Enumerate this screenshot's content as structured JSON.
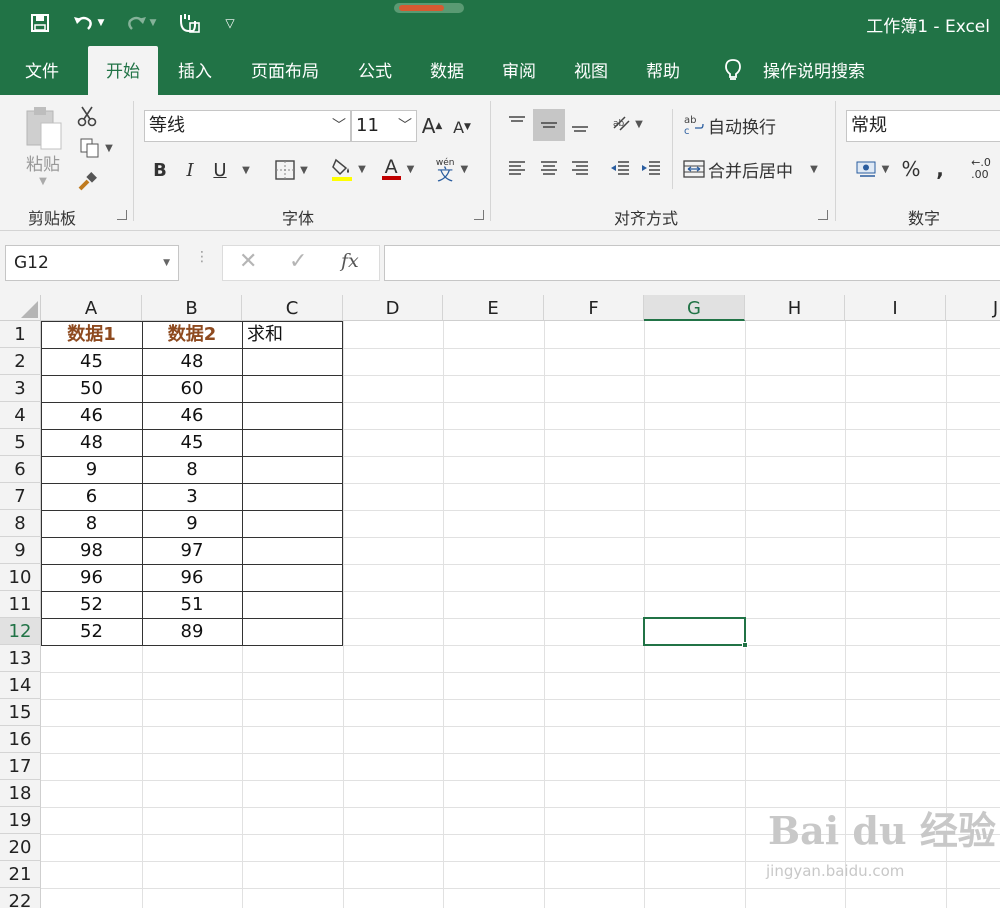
{
  "window": {
    "title": "工作簿1  -  Excel"
  },
  "ribbon_tabs": [
    {
      "label": "文件"
    },
    {
      "label": "开始"
    },
    {
      "label": "插入"
    },
    {
      "label": "页面布局"
    },
    {
      "label": "公式"
    },
    {
      "label": "数据"
    },
    {
      "label": "审阅"
    },
    {
      "label": "视图"
    },
    {
      "label": "帮助"
    },
    {
      "label": "操作说明搜索"
    }
  ],
  "clipboard": {
    "paste_label": "粘贴",
    "group_label": "剪贴板"
  },
  "font": {
    "name": "等线",
    "size": "11",
    "group_label": "字体",
    "bold": "B",
    "italic": "I",
    "underline": "U",
    "color_letter": "A",
    "phonetic_top": "wén",
    "phonetic_bottom": "文"
  },
  "alignment": {
    "wrap_text": "自动换行",
    "merge_center": "合并后居中",
    "group_label": "对齐方式"
  },
  "number": {
    "format": "常规",
    "group_label": "数字",
    "percent": "%",
    "comma": ",",
    "increase_decimal": "←.0\n.00"
  },
  "formula_bar": {
    "name_box": "G12",
    "fx": "fx",
    "value": ""
  },
  "columns": [
    "A",
    "B",
    "C",
    "D",
    "E",
    "F",
    "G",
    "H",
    "I",
    "J"
  ],
  "rows": [
    "1",
    "2",
    "3",
    "4",
    "5",
    "6",
    "7",
    "8",
    "9",
    "10",
    "11",
    "12",
    "13",
    "14",
    "15",
    "16",
    "17",
    "18",
    "19",
    "20",
    "21",
    "22"
  ],
  "cells": {
    "A1": "数据1",
    "B1": "数据2",
    "C1": "求和",
    "A": [
      "45",
      "50",
      "46",
      "48",
      "9",
      "6",
      "8",
      "98",
      "96",
      "52",
      "52"
    ],
    "B": [
      "48",
      "60",
      "46",
      "45",
      "8",
      "3",
      "9",
      "97",
      "96",
      "51",
      "89"
    ]
  },
  "watermark": {
    "main": "Bai du 经验",
    "url": "jingyan.baidu.com"
  },
  "colors": {
    "brand": "#217346",
    "header_text": "#8e4a1f"
  }
}
